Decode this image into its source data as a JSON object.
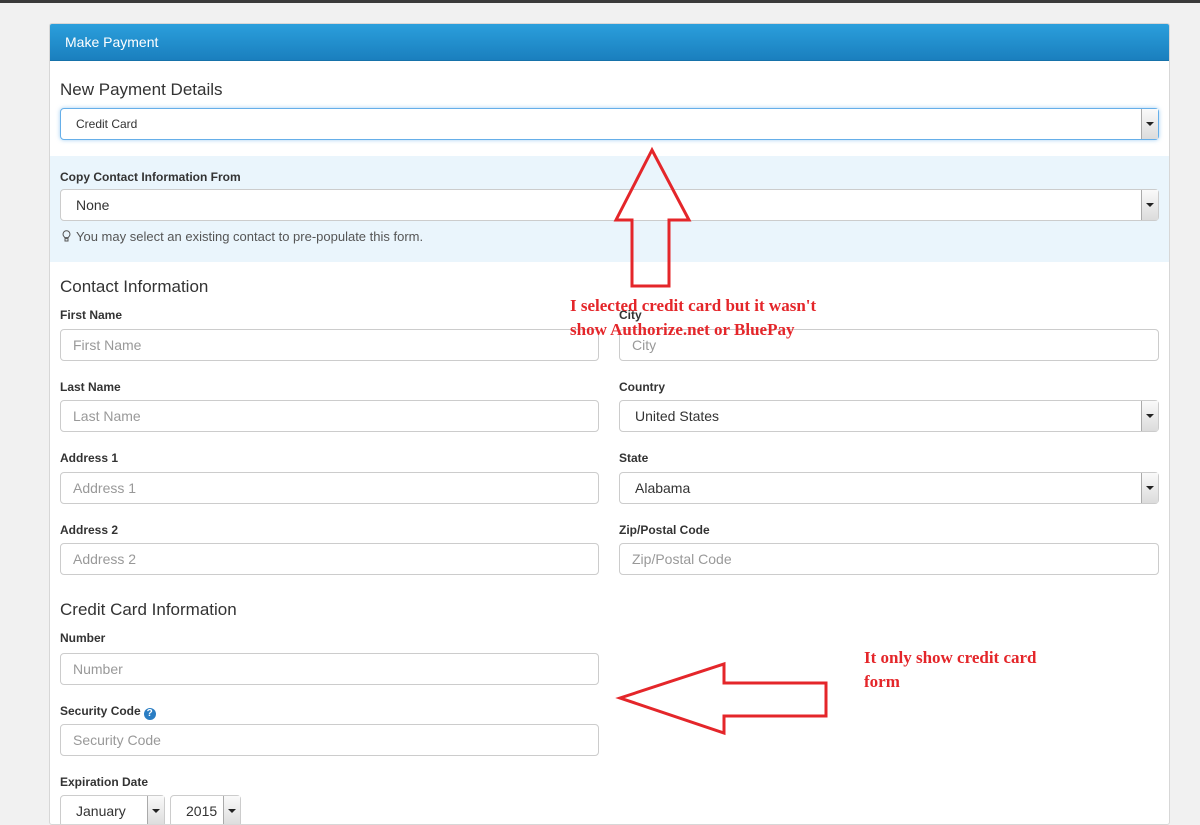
{
  "panel": {
    "title": "Make Payment"
  },
  "payment": {
    "section_title": "New Payment Details",
    "method_value": "Credit Card"
  },
  "copy_contact": {
    "label": "Copy Contact Information From",
    "value": "None",
    "hint": "You may select an existing contact to pre-populate this form."
  },
  "contact": {
    "section_title": "Contact Information",
    "first_name": {
      "label": "First Name",
      "placeholder": "First Name"
    },
    "last_name": {
      "label": "Last Name",
      "placeholder": "Last Name"
    },
    "address1": {
      "label": "Address 1",
      "placeholder": "Address 1"
    },
    "address2": {
      "label": "Address 2",
      "placeholder": "Address 2"
    },
    "city": {
      "label": "City",
      "placeholder": "City"
    },
    "country": {
      "label": "Country",
      "value": "United States"
    },
    "state": {
      "label": "State",
      "value": "Alabama"
    },
    "zip": {
      "label": "Zip/Postal Code",
      "placeholder": "Zip/Postal Code"
    }
  },
  "credit_card": {
    "section_title": "Credit Card Information",
    "number": {
      "label": "Number",
      "placeholder": "Number"
    },
    "security_code": {
      "label": "Security Code",
      "placeholder": "Security Code",
      "help_icon": "?"
    },
    "expiration": {
      "label": "Expiration Date",
      "month_value": "January",
      "year_value": "2015"
    }
  },
  "annotations": {
    "note1_line1": "I selected credit card but it wasn't",
    "note1_line2": "show Authorize.net or BluePay",
    "note2_line1": "It only show credit card",
    "note2_line2": "form",
    "color": "#e4262a"
  },
  "colors": {
    "header": "#1a7fbe",
    "contact_box": "#eaf5fc"
  }
}
